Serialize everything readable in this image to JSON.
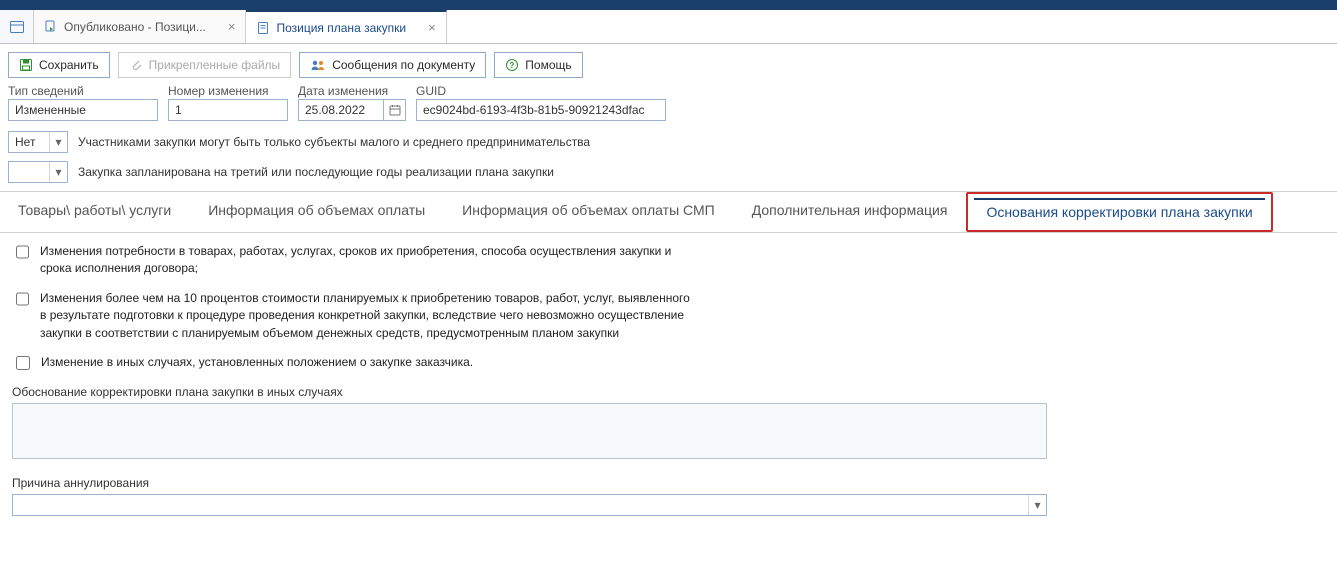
{
  "tabs": {
    "first_label": "Опубликовано - Позици...",
    "second_label": "Позиция плана закупки"
  },
  "toolbar": {
    "save_label": "Сохранить",
    "attach_label": "Прикрепленные файлы",
    "messages_label": "Сообщения по документу",
    "help_label": "Помощь"
  },
  "fields": {
    "type_label": "Тип сведений",
    "type_value": "Измененные",
    "change_no_label": "Номер изменения",
    "change_no_value": "1",
    "change_date_label": "Дата изменения",
    "change_date_value": "25.08.2022",
    "guid_label": "GUID",
    "guid_value": "ec9024bd-6193-4f3b-81b5-90921243dfac"
  },
  "flags": {
    "smb_value": "Нет",
    "smb_label": "Участниками закупки могут быть только субъекты малого и среднего предпринимательства",
    "thirdyear_value": "",
    "thirdyear_label": "Закупка запланирована на третий или последующие годы реализации плана закупки"
  },
  "subtabs": {
    "goods": "Товары\\ работы\\ услуги",
    "volumes": "Информация об объемах оплаты",
    "volumes_smb": "Информация об объемах оплаты СМП",
    "additional": "Дополнительная информация",
    "correction_basis": "Основания корректировки плана закупки"
  },
  "checkboxes": {
    "cb1": "Изменения потребности в товарах, работах, услугах, сроков их приобретения, способа осуществления закупки и срока исполнения договора;",
    "cb2": "Изменения более чем на 10 процентов стоимости планируемых к приобретению товаров, работ, услуг, выявленного в результате подготовки к процедуре проведения конкретной закупки, вследствие чего невозможно осуществление закупки в соответствии с планируемым объемом денежных средств, предусмотренным планом закупки",
    "cb3": "Изменение в иных случаях, установленных положением о закупке заказчика."
  },
  "sections": {
    "justification_label": "Обоснование корректировки плана закупки в иных случаях",
    "justification_value": "",
    "cancel_reason_label": "Причина аннулирования",
    "cancel_reason_value": ""
  }
}
